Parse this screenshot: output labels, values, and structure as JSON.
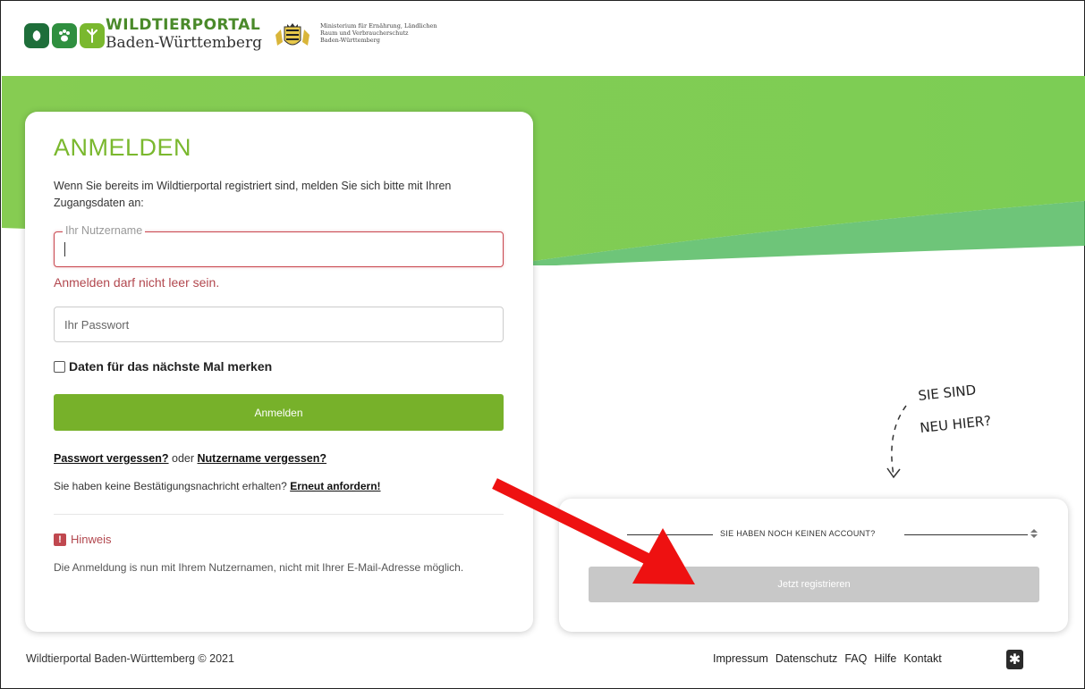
{
  "header": {
    "brand_top": "WILDTIERPORTAL",
    "brand_bottom": "Baden-Württemberg",
    "ministry_line1": "Ministerium für Ernährung, Ländlichen",
    "ministry_line2": "Raum und Verbraucherschutz",
    "ministry_line3": "Baden-Württemberg"
  },
  "login": {
    "title": "ANMELDEN",
    "intro": "Wenn Sie bereits im Wildtierportal registriert sind, melden Sie sich bitte mit Ihren Zugangsdaten an:",
    "username_legend": "Ihr Nutzername",
    "username_value": "",
    "username_error": "Anmelden darf nicht leer sein.",
    "password_placeholder": "Ihr Passwort",
    "remember_label": "Daten für das nächste Mal merken",
    "remember_checked": false,
    "submit_label": "Anmelden",
    "forgot_password": "Passwort vergessen?",
    "forgot_or": " oder ",
    "forgot_username": "Nutzername vergessen?",
    "resend_text": "Sie haben keine Bestätigungsnachricht erhalten? ",
    "resend_link": "Erneut anfordern!",
    "hint_icon": "!",
    "hint_title": "Hinweis",
    "hint_text": "Die Anmeldung is nun mit Ihrem Nutzernamen, nicht mit Ihrer E-Mail-Adresse möglich."
  },
  "register": {
    "no_account": "SIE HABEN NOCH KEINEN ACCOUNT?",
    "button_label": "Jetzt registrieren"
  },
  "doodle": {
    "line1": "SIE SIND",
    "line2": "NEU HIER?"
  },
  "footer": {
    "copyright": "Wildtierportal Baden-Württemberg © 2021",
    "links": [
      "Impressum",
      "Datenschutz",
      "FAQ",
      "Hilfe",
      "Kontakt"
    ]
  },
  "colors": {
    "brand_green": "#7ab82e",
    "button_green": "#77b12a",
    "error_red": "#b2474e",
    "annotation_arrow": "#ee1111"
  }
}
